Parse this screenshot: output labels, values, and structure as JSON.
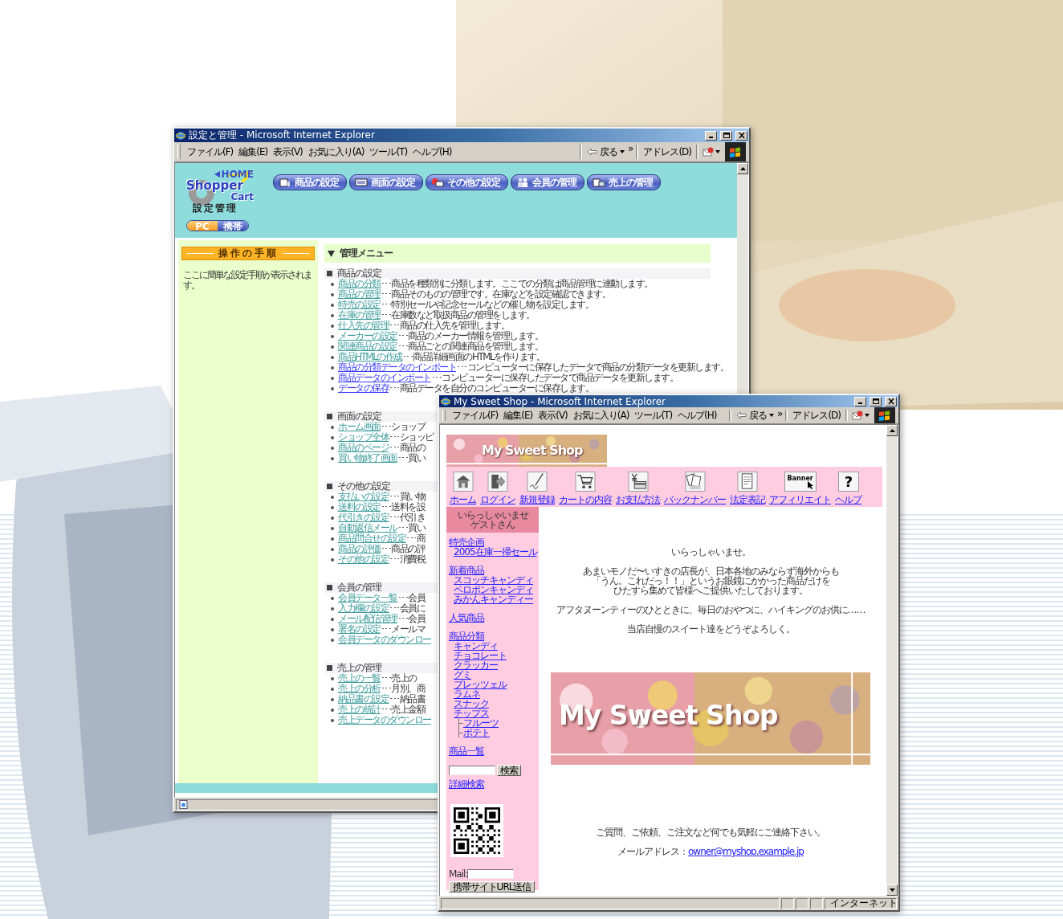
{
  "admin_window": {
    "title": "設定と管理 - Microsoft Internet Explorer",
    "menu": [
      "ファイル(F)",
      "編集(E)",
      "表示(V)",
      "お気に入り(A)",
      "ツール(T)",
      "ヘルプ(H)"
    ],
    "toolbar": {
      "back": "戻る",
      "more": "»",
      "address": "アドレス(D)"
    },
    "logo": {
      "home": "HOME",
      "line1": "Shopper",
      "line2": "Cart",
      "subtitle": "設定管理"
    },
    "device_toggle": [
      {
        "label": "PC",
        "selected": true
      },
      {
        "label": "携帯",
        "selected": false
      }
    ],
    "nav_buttons": [
      "商品の設定",
      "画面の設定",
      "その他の設定",
      "会員の管理",
      "売上の管理"
    ],
    "steps_panel": {
      "title": "操作の手順",
      "text": "ここに簡単な設定手順が表示されます。"
    },
    "menu_title": "管理メニュー",
    "sections": [
      {
        "title": "商品の設定",
        "items": [
          {
            "link": "商品の分類",
            "text": "･･･商品を種類別に分類します。ここでの分類は商品管理に連動します。",
            "visited": true
          },
          {
            "link": "商品の管理",
            "text": "･･･商品そのものの管理です。在庫などを設定確認できます。",
            "visited": true
          },
          {
            "link": "特売の設定",
            "text": "･･･特別セールや記念セールなどの催し物を設定します。",
            "visited": true
          },
          {
            "link": "在庫の管理",
            "text": "･･･在庫数など取扱商品の管理をします。",
            "visited": true
          },
          {
            "link": "仕入先の管理",
            "text": "･･･商品の仕入先を管理します。",
            "visited": true
          },
          {
            "link": "メーカーの設定",
            "text": "･･･商品のメーカー情報を管理します。",
            "visited": true
          },
          {
            "link": "関連商品の設定",
            "text": "･･･商品ごとの関連商品を管理します。",
            "visited": true
          },
          {
            "link": "商品HTMLの作成",
            "text": "･･･商品詳細画面のHTMLを作ります。",
            "visited": true
          },
          {
            "link": "商品の分類データのインポート",
            "text": "･･･コンピューターに保存したデータで商品の分類データを更新します。",
            "visited": false
          },
          {
            "link": "商品データのインポート",
            "text": "･･･コンピューターに保存したデータで商品データを更新します。",
            "visited": false
          },
          {
            "link": "データの保存",
            "text": "･･･商品データを自分のコンピューターに保存します。",
            "visited": false
          }
        ]
      },
      {
        "title": "画面の設定",
        "items": [
          {
            "link": "ホーム画面",
            "text": "･･･ショップ",
            "visited": true
          },
          {
            "link": "ショップ全体",
            "text": "･･･ショッピ",
            "visited": true
          },
          {
            "link": "商品のページ",
            "text": "･･･商品の",
            "visited": true
          },
          {
            "link": "買い物終了画面",
            "text": "･･･買い",
            "visited": true
          }
        ]
      },
      {
        "title": "その他の設定",
        "items": [
          {
            "link": "支払いの設定",
            "text": "･･･買い物",
            "visited": true
          },
          {
            "link": "送料の設定",
            "text": "･･･送料を設",
            "visited": true
          },
          {
            "link": "代引きの設定",
            "text": "･･･代引き",
            "visited": true
          },
          {
            "link": "自動返信メール",
            "text": "･･･買い",
            "visited": true
          },
          {
            "link": "商品問合せの設定",
            "text": "･･･商",
            "visited": true
          },
          {
            "link": "商品の評価",
            "text": "･･･商品の評",
            "visited": true
          },
          {
            "link": "その他の設定",
            "text": "･･･消費税",
            "visited": true
          }
        ]
      },
      {
        "title": "会員の管理",
        "items": [
          {
            "link": "会員データ一覧",
            "text": "･･･会員",
            "visited": true
          },
          {
            "link": "入力欄の設定",
            "text": "･･･会員に",
            "visited": true
          },
          {
            "link": "メール配信管理",
            "text": "･･･会員",
            "visited": true
          },
          {
            "link": "署名の設定",
            "text": "･･･メールマ",
            "visited": true
          },
          {
            "link": "会員データのダウンロー",
            "visited": true
          }
        ]
      },
      {
        "title": "売上の管理",
        "items": [
          {
            "link": "売上の一覧",
            "text": "･･･売上の",
            "visited": true
          },
          {
            "link": "売上の分析",
            "text": "･･･月別、商",
            "visited": true
          },
          {
            "link": "納品書の設定",
            "text": "･･･納品書",
            "visited": true
          },
          {
            "link": "売上の統計",
            "text": "･･･売上金額",
            "visited": true
          },
          {
            "link": "売上データのダウンロー",
            "visited": true
          }
        ]
      }
    ]
  },
  "shop_window": {
    "title": "My Sweet Shop - Microsoft Internet Explorer",
    "menu": [
      "ファイル(F)",
      "編集(E)",
      "表示(V)",
      "お気に入り(A)",
      "ツール(T)",
      "ヘルプ(H)"
    ],
    "toolbar": {
      "back": "戻る",
      "more": "»",
      "address": "アドレス(D)"
    },
    "status_zone": "インターネット",
    "banner": {
      "kind": "picture",
      "title": "My Sweet Shop"
    },
    "nav": [
      {
        "label": "ホーム"
      },
      {
        "label": "ログイン"
      },
      {
        "label": "新規登録"
      },
      {
        "label": "カートの内容"
      },
      {
        "label": "お支払方法"
      },
      {
        "label": "バックナンバー"
      },
      {
        "label": "法定表記"
      },
      {
        "label": "アフィリエイト",
        "glyph": "Banner"
      },
      {
        "label": "ヘルプ",
        "glyph": "?"
      }
    ],
    "sidebar": {
      "greeting": [
        "いらっしゃいませ",
        "ゲストさん"
      ],
      "groups": [
        {
          "title": "特売企画",
          "items": [
            {
              "label": "2005在庫一掃セール"
            }
          ]
        },
        {
          "title": "新着商品",
          "items": [
            {
              "label": "スコッチキャンディ"
            },
            {
              "label": "ペロポンキャンディ"
            },
            {
              "label": "みかんキャンディー"
            }
          ]
        },
        {
          "title": "人気商品"
        },
        {
          "title": "商品分類",
          "items": [
            {
              "label": "キャンディ"
            },
            {
              "label": "チョコレート"
            },
            {
              "label": "クラッカー"
            },
            {
              "label": "グミ"
            },
            {
              "label": "プレッツェル"
            },
            {
              "label": "ラムネ"
            },
            {
              "label": "スナック"
            },
            {
              "label": "チップス",
              "children": [
                {
                  "label": "フルーツ"
                },
                {
                  "label": "ポテト"
                }
              ]
            }
          ]
        },
        {
          "title": "商品一覧"
        }
      ],
      "search": {
        "button": "検索",
        "advanced": "詳細検索"
      },
      "mail": {
        "label": "Mail:",
        "button": "携帯サイトURL送信"
      }
    },
    "main": {
      "welcome": "いらっしゃいませ。",
      "intro": [
        "あまいモノだ〜いすきの店長が、日本各地のみならず海外からも",
        "「うん。これだっ！！」というお眼鏡にかかった商品だけを",
        "ひたすら集めて皆様へご提供いたしております。"
      ],
      "tagline": "アフタヌーンティーのひとときに、毎日のおやつに、ハイキングのお供に……",
      "closing": "当店自慢のスイート達をどうぞよろしく。",
      "hero": {
        "kind": "picture",
        "title": "My Sweet Shop"
      },
      "contact": "ご質問、ご依頼、ご注文など何でも気軽にご連絡下さい。",
      "email_label": "メールアドレス：",
      "email": "owner@myshop.example.jp"
    }
  }
}
